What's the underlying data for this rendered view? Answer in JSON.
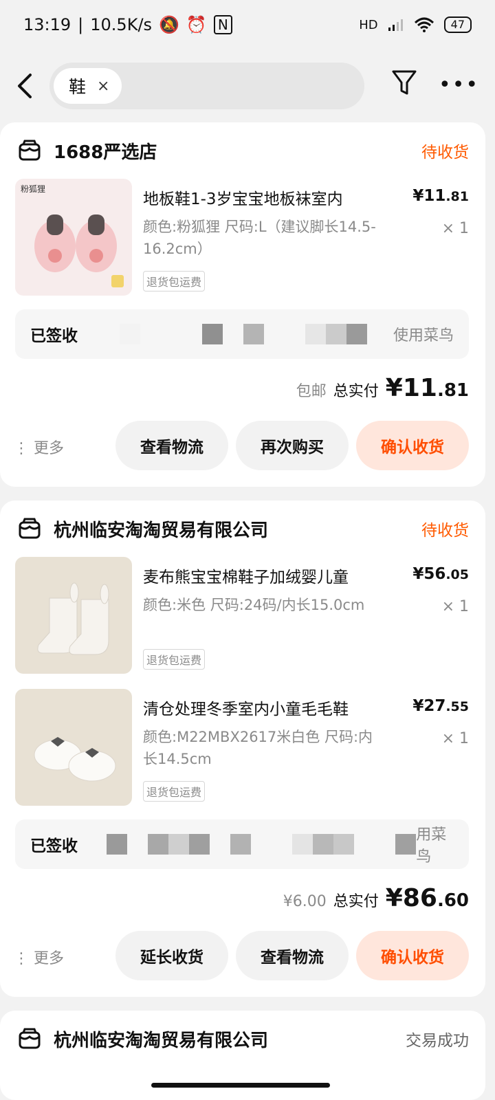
{
  "status_bar": {
    "time": "13:19",
    "speed": "10.5K/s",
    "network": "HD",
    "battery": "47"
  },
  "search": {
    "chip": "鞋",
    "clear": "×"
  },
  "orders": [
    {
      "shop": "1688严选店",
      "status": "待收货",
      "items": [
        {
          "title": "地板鞋1-3岁宝宝地板袜室内",
          "spec": "颜色:粉狐狸 尺码:L（建议脚长14.5-16.2cm）",
          "tag": "退货包运费",
          "price_int": "¥11",
          "price_dec": ".81",
          "qty": "× 1",
          "thumb_label": "粉狐狸"
        }
      ],
      "logistics": {
        "status": "已签收",
        "carrier": "使用菜鸟"
      },
      "total": {
        "extra": "包邮",
        "label": "总实付",
        "amount_int": "¥11",
        "amount_dec": ".81"
      },
      "actions": {
        "more": "更多",
        "b1": "查看物流",
        "b2": "再次购买",
        "b3": "确认收货"
      }
    },
    {
      "shop": "杭州临安淘淘贸易有限公司",
      "status": "待收货",
      "items": [
        {
          "title": "麦布熊宝宝棉鞋子加绒婴儿童",
          "spec": "颜色:米色 尺码:24码/内长15.0cm",
          "tag": "退货包运费",
          "price_int": "¥56",
          "price_dec": ".05",
          "qty": "× 1"
        },
        {
          "title": "清仓处理冬季室内小童毛毛鞋",
          "spec": "颜色:M22MBX2617米白色 尺码:内长14.5cm",
          "tag": "退货包运费",
          "price_int": "¥27",
          "price_dec": ".55",
          "qty": "× 1"
        }
      ],
      "logistics": {
        "status": "已签收",
        "carrier": "用菜鸟"
      },
      "total": {
        "extra": "¥6.00",
        "label": "总实付",
        "amount_int": "¥86",
        "amount_dec": ".60"
      },
      "actions": {
        "more": "更多",
        "b1": "延长收货",
        "b2": "查看物流",
        "b3": "确认收货"
      }
    },
    {
      "shop": "杭州临安淘淘贸易有限公司",
      "status": "交易成功"
    }
  ],
  "colors": {
    "accent": "#ff5a00",
    "primary_btn_bg": "#ffe6dc",
    "background": "#f2f2f2"
  }
}
